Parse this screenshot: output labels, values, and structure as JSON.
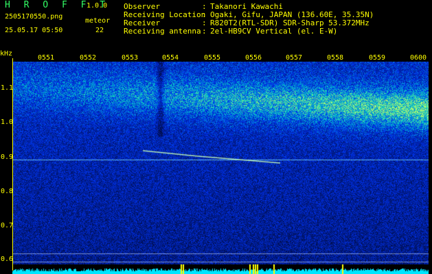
{
  "header": {
    "app_name": "H R O F F T",
    "version": "1.0.0",
    "filename": "2505170550.png",
    "datetime": "25.05.17 05:50",
    "meteor_label": "meteor",
    "meteor_count": "22"
  },
  "info": [
    {
      "label": "Observer",
      "value": "Takanori Kawachi"
    },
    {
      "label": "Receiving Location",
      "value": "Ogaki, Gifu, JAPAN (136.60E, 35.35N)"
    },
    {
      "label": "Receiver",
      "value": "R820T2(RTL-SDR) SDR-Sharp 53.372MHz"
    },
    {
      "label": "Receiving antenna",
      "value": "2el-HB9CV Vertical (el. E-W)"
    }
  ],
  "axes": {
    "y_unit": "kHz",
    "y_ticks": [
      "1.1",
      "1.0",
      "0.9",
      "0.8",
      "0.7",
      "0.6"
    ],
    "x_ticks": [
      "0551",
      "0552",
      "0553",
      "0554",
      "0555",
      "0556",
      "0557",
      "0558",
      "0559",
      "0600"
    ]
  },
  "colors": {
    "background": "#000000",
    "label": "#ffff00",
    "logo": "#33ff66",
    "spectrum_low": "#000a3a",
    "spectrum_high": "#ffff66",
    "signal_bar": "#00e5ff"
  }
}
